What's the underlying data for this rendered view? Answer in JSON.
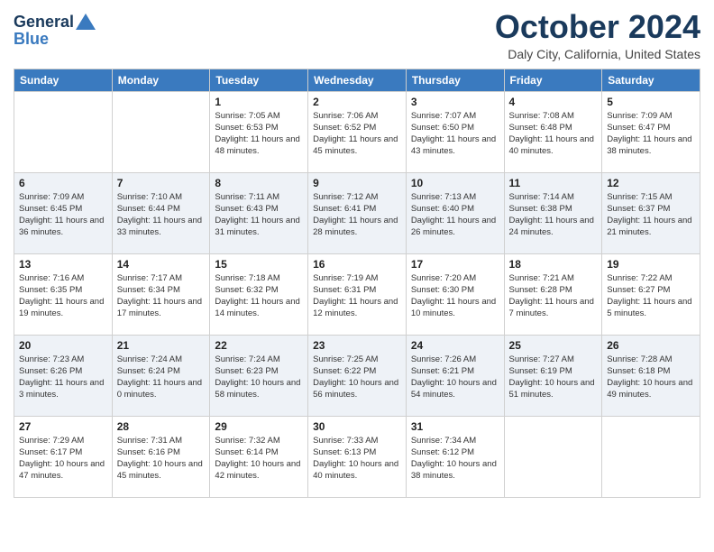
{
  "header": {
    "logo_line1": "General",
    "logo_line2": "Blue",
    "month": "October 2024",
    "location": "Daly City, California, United States"
  },
  "weekdays": [
    "Sunday",
    "Monday",
    "Tuesday",
    "Wednesday",
    "Thursday",
    "Friday",
    "Saturday"
  ],
  "weeks": [
    [
      {
        "day": null
      },
      {
        "day": null
      },
      {
        "day": "1",
        "sunrise": "Sunrise: 7:05 AM",
        "sunset": "Sunset: 6:53 PM",
        "daylight": "Daylight: 11 hours and 48 minutes."
      },
      {
        "day": "2",
        "sunrise": "Sunrise: 7:06 AM",
        "sunset": "Sunset: 6:52 PM",
        "daylight": "Daylight: 11 hours and 45 minutes."
      },
      {
        "day": "3",
        "sunrise": "Sunrise: 7:07 AM",
        "sunset": "Sunset: 6:50 PM",
        "daylight": "Daylight: 11 hours and 43 minutes."
      },
      {
        "day": "4",
        "sunrise": "Sunrise: 7:08 AM",
        "sunset": "Sunset: 6:48 PM",
        "daylight": "Daylight: 11 hours and 40 minutes."
      },
      {
        "day": "5",
        "sunrise": "Sunrise: 7:09 AM",
        "sunset": "Sunset: 6:47 PM",
        "daylight": "Daylight: 11 hours and 38 minutes."
      }
    ],
    [
      {
        "day": "6",
        "sunrise": "Sunrise: 7:09 AM",
        "sunset": "Sunset: 6:45 PM",
        "daylight": "Daylight: 11 hours and 36 minutes."
      },
      {
        "day": "7",
        "sunrise": "Sunrise: 7:10 AM",
        "sunset": "Sunset: 6:44 PM",
        "daylight": "Daylight: 11 hours and 33 minutes."
      },
      {
        "day": "8",
        "sunrise": "Sunrise: 7:11 AM",
        "sunset": "Sunset: 6:43 PM",
        "daylight": "Daylight: 11 hours and 31 minutes."
      },
      {
        "day": "9",
        "sunrise": "Sunrise: 7:12 AM",
        "sunset": "Sunset: 6:41 PM",
        "daylight": "Daylight: 11 hours and 28 minutes."
      },
      {
        "day": "10",
        "sunrise": "Sunrise: 7:13 AM",
        "sunset": "Sunset: 6:40 PM",
        "daylight": "Daylight: 11 hours and 26 minutes."
      },
      {
        "day": "11",
        "sunrise": "Sunrise: 7:14 AM",
        "sunset": "Sunset: 6:38 PM",
        "daylight": "Daylight: 11 hours and 24 minutes."
      },
      {
        "day": "12",
        "sunrise": "Sunrise: 7:15 AM",
        "sunset": "Sunset: 6:37 PM",
        "daylight": "Daylight: 11 hours and 21 minutes."
      }
    ],
    [
      {
        "day": "13",
        "sunrise": "Sunrise: 7:16 AM",
        "sunset": "Sunset: 6:35 PM",
        "daylight": "Daylight: 11 hours and 19 minutes."
      },
      {
        "day": "14",
        "sunrise": "Sunrise: 7:17 AM",
        "sunset": "Sunset: 6:34 PM",
        "daylight": "Daylight: 11 hours and 17 minutes."
      },
      {
        "day": "15",
        "sunrise": "Sunrise: 7:18 AM",
        "sunset": "Sunset: 6:32 PM",
        "daylight": "Daylight: 11 hours and 14 minutes."
      },
      {
        "day": "16",
        "sunrise": "Sunrise: 7:19 AM",
        "sunset": "Sunset: 6:31 PM",
        "daylight": "Daylight: 11 hours and 12 minutes."
      },
      {
        "day": "17",
        "sunrise": "Sunrise: 7:20 AM",
        "sunset": "Sunset: 6:30 PM",
        "daylight": "Daylight: 11 hours and 10 minutes."
      },
      {
        "day": "18",
        "sunrise": "Sunrise: 7:21 AM",
        "sunset": "Sunset: 6:28 PM",
        "daylight": "Daylight: 11 hours and 7 minutes."
      },
      {
        "day": "19",
        "sunrise": "Sunrise: 7:22 AM",
        "sunset": "Sunset: 6:27 PM",
        "daylight": "Daylight: 11 hours and 5 minutes."
      }
    ],
    [
      {
        "day": "20",
        "sunrise": "Sunrise: 7:23 AM",
        "sunset": "Sunset: 6:26 PM",
        "daylight": "Daylight: 11 hours and 3 minutes."
      },
      {
        "day": "21",
        "sunrise": "Sunrise: 7:24 AM",
        "sunset": "Sunset: 6:24 PM",
        "daylight": "Daylight: 11 hours and 0 minutes."
      },
      {
        "day": "22",
        "sunrise": "Sunrise: 7:24 AM",
        "sunset": "Sunset: 6:23 PM",
        "daylight": "Daylight: 10 hours and 58 minutes."
      },
      {
        "day": "23",
        "sunrise": "Sunrise: 7:25 AM",
        "sunset": "Sunset: 6:22 PM",
        "daylight": "Daylight: 10 hours and 56 minutes."
      },
      {
        "day": "24",
        "sunrise": "Sunrise: 7:26 AM",
        "sunset": "Sunset: 6:21 PM",
        "daylight": "Daylight: 10 hours and 54 minutes."
      },
      {
        "day": "25",
        "sunrise": "Sunrise: 7:27 AM",
        "sunset": "Sunset: 6:19 PM",
        "daylight": "Daylight: 10 hours and 51 minutes."
      },
      {
        "day": "26",
        "sunrise": "Sunrise: 7:28 AM",
        "sunset": "Sunset: 6:18 PM",
        "daylight": "Daylight: 10 hours and 49 minutes."
      }
    ],
    [
      {
        "day": "27",
        "sunrise": "Sunrise: 7:29 AM",
        "sunset": "Sunset: 6:17 PM",
        "daylight": "Daylight: 10 hours and 47 minutes."
      },
      {
        "day": "28",
        "sunrise": "Sunrise: 7:31 AM",
        "sunset": "Sunset: 6:16 PM",
        "daylight": "Daylight: 10 hours and 45 minutes."
      },
      {
        "day": "29",
        "sunrise": "Sunrise: 7:32 AM",
        "sunset": "Sunset: 6:14 PM",
        "daylight": "Daylight: 10 hours and 42 minutes."
      },
      {
        "day": "30",
        "sunrise": "Sunrise: 7:33 AM",
        "sunset": "Sunset: 6:13 PM",
        "daylight": "Daylight: 10 hours and 40 minutes."
      },
      {
        "day": "31",
        "sunrise": "Sunrise: 7:34 AM",
        "sunset": "Sunset: 6:12 PM",
        "daylight": "Daylight: 10 hours and 38 minutes."
      },
      {
        "day": null
      },
      {
        "day": null
      }
    ]
  ]
}
